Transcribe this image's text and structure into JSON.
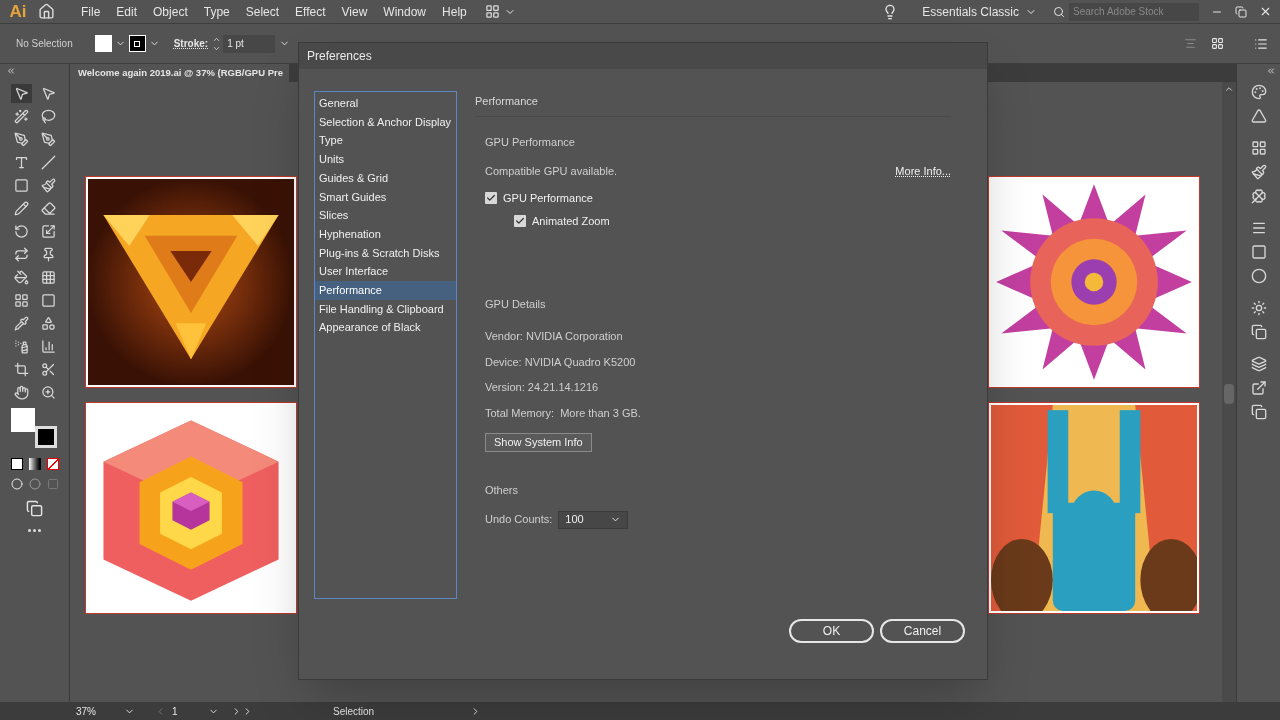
{
  "app": {
    "logo": "Ai",
    "menu": [
      "File",
      "Edit",
      "Object",
      "Type",
      "Select",
      "Effect",
      "View",
      "Window",
      "Help"
    ],
    "workspace": "Essentials Classic",
    "search": {
      "placeholder": "Search Adobe Stock"
    }
  },
  "control_bar": {
    "selection": "No Selection",
    "stroke_label": "Stroke:",
    "stroke_value": "1 pt"
  },
  "document_tab": "Welcome again 2019.ai @ 37% (RGB/GPU Pre",
  "dialog": {
    "title": "Preferences",
    "categories": [
      {
        "label": "General",
        "selected": false
      },
      {
        "label": "Selection & Anchor Display",
        "selected": false
      },
      {
        "label": "Type",
        "selected": false
      },
      {
        "label": "Units",
        "selected": false
      },
      {
        "label": "Guides & Grid",
        "selected": false
      },
      {
        "label": "Smart Guides",
        "selected": false
      },
      {
        "label": "Slices",
        "selected": false
      },
      {
        "label": "Hyphenation",
        "selected": false
      },
      {
        "label": "Plug-ins & Scratch Disks",
        "selected": false
      },
      {
        "label": "User Interface",
        "selected": false
      },
      {
        "label": "Performance",
        "selected": true
      },
      {
        "label": "File Handling & Clipboard",
        "selected": false
      },
      {
        "label": "Appearance of Black",
        "selected": false
      }
    ],
    "section": "Performance",
    "gpu_performance": {
      "heading": "GPU Performance",
      "status": "Compatible GPU available.",
      "link": "More Info...",
      "options": [
        {
          "label": "GPU Performance",
          "checked": true,
          "children": [
            {
              "label": "Animated Zoom",
              "checked": true
            }
          ]
        }
      ]
    },
    "gpu_details": {
      "heading": "GPU Details",
      "lines": [
        "Vendor: NVIDIA Corporation",
        "Device: NVIDIA Quadro K5200",
        "Version: 24.21.14.1216",
        "Total Memory:  More than 3 GB."
      ],
      "button": "Show System Info"
    },
    "others": {
      "heading": "Others",
      "label": "Undo Counts:",
      "value": "100"
    },
    "buttons": [
      "OK",
      "Cancel"
    ]
  },
  "status_bar": {
    "zoom": "37%",
    "page": "1",
    "tool": "Selection"
  }
}
